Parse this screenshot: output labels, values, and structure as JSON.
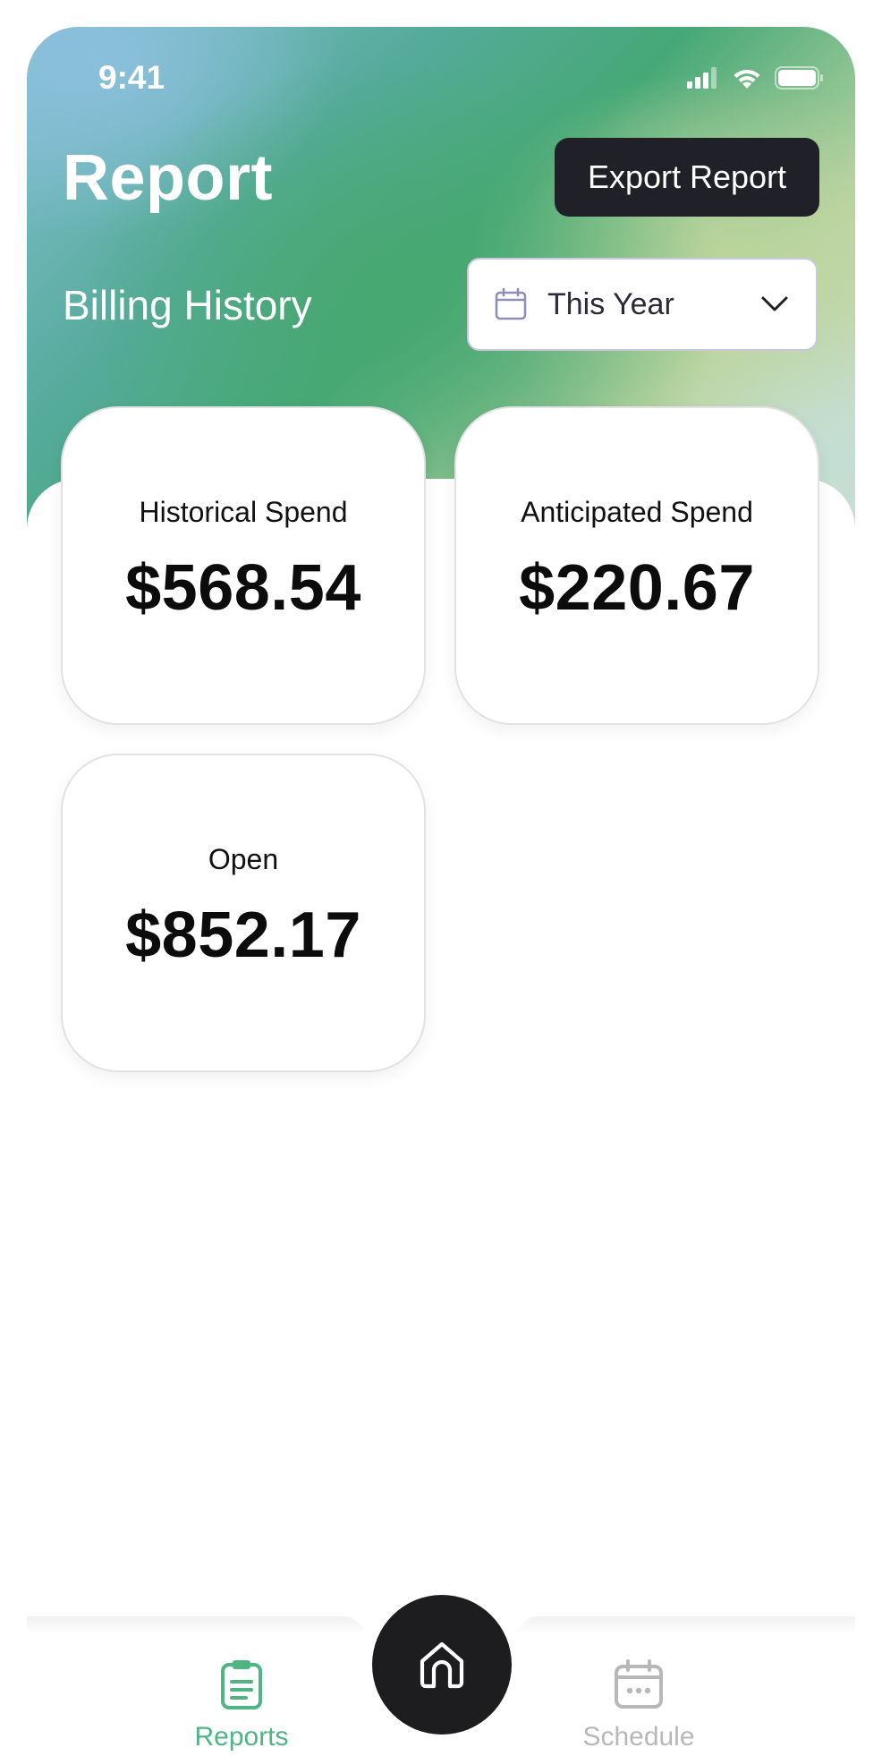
{
  "status_bar": {
    "time": "9:41"
  },
  "header": {
    "title": "Report",
    "export_label": "Export Report",
    "section_label": "Billing History",
    "period_select": {
      "value": "This Year"
    }
  },
  "cards": [
    {
      "label": "Historical Spend",
      "value": "$568.54"
    },
    {
      "label": "Anticipated Spend",
      "value": "$220.67"
    },
    {
      "label": "Open",
      "value": "$852.17"
    }
  ],
  "tab_bar": {
    "items": [
      {
        "label": "Reports",
        "icon": "clipboard-icon",
        "active": true
      },
      {
        "label": "Schedule",
        "icon": "calendar-icon",
        "active": false
      }
    ],
    "home_icon": "home-icon"
  },
  "colors": {
    "accent_green": "#4fb583",
    "inactive_gray": "#b8b8b8",
    "dark_button": "#1f2028"
  }
}
